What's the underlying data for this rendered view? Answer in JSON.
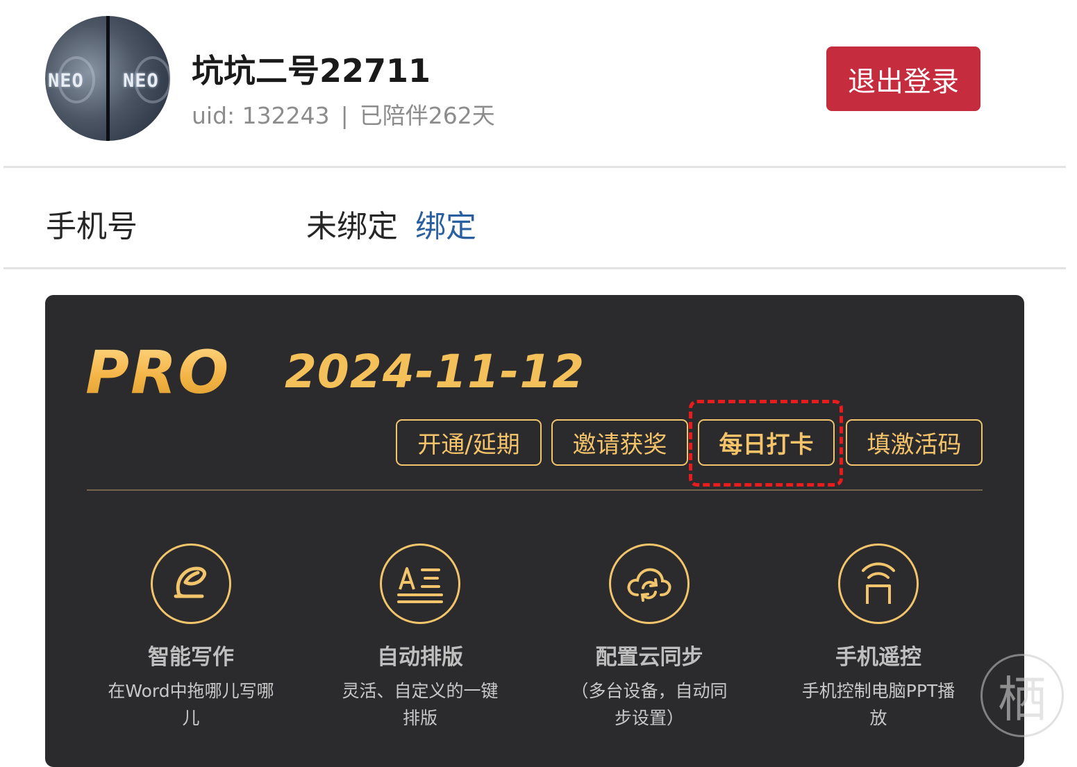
{
  "profile": {
    "username": "坑坑二号22711",
    "uid": "uid: 132243",
    "separator": "|",
    "companion_days": "已陪伴262天",
    "avatar_text": "NEO",
    "logout_label": "退出登录"
  },
  "phone": {
    "label": "手机号",
    "status": "未绑定",
    "bind_label": "绑定"
  },
  "pro": {
    "badge": "PRO",
    "expiry_date": "2024-11-12",
    "buttons": [
      {
        "label": "开通/延期"
      },
      {
        "label": "邀请获奖"
      },
      {
        "label": "每日打卡"
      },
      {
        "label": "填激活码"
      }
    ],
    "features": [
      {
        "icon": "pen-icon",
        "name": "智能写作",
        "desc": "在Word中拖哪儿写哪儿"
      },
      {
        "icon": "text-format-icon",
        "name": "自动排版",
        "desc": "灵活、自定义的一键排版"
      },
      {
        "icon": "cloud-sync-icon",
        "name": "配置云同步",
        "desc": "（多台设备，自动同步设置）"
      },
      {
        "icon": "remote-control-icon",
        "name": "手机遥控",
        "desc": "手机控制电脑PPT播放"
      }
    ]
  },
  "watermark": {
    "glyph": "栖"
  },
  "colors": {
    "accent_gold": "#f2c46b",
    "logout_red": "#c52d3e",
    "card_bg": "#2b2b2d",
    "link_blue": "#2a5fa0",
    "highlight_red": "#e81c1c"
  }
}
